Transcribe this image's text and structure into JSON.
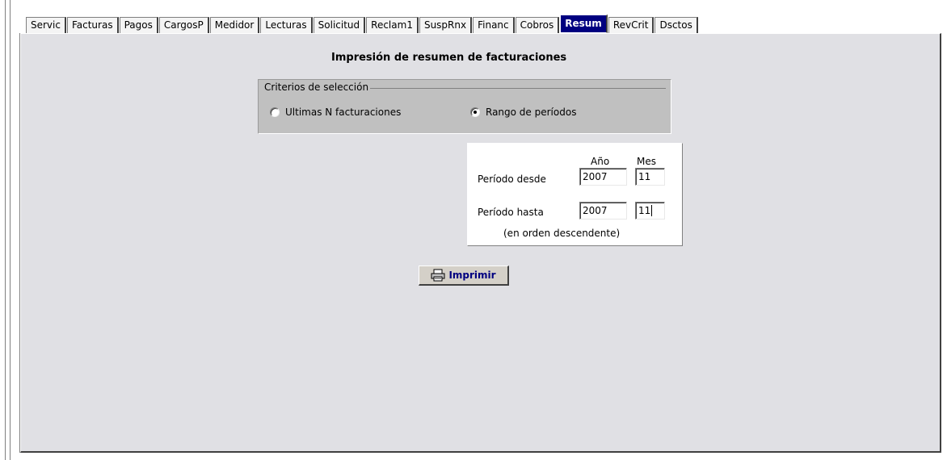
{
  "tabs": [
    {
      "label": "Servic"
    },
    {
      "label": "Facturas"
    },
    {
      "label": "Pagos"
    },
    {
      "label": "CargosP"
    },
    {
      "label": "Medidor"
    },
    {
      "label": "Lecturas"
    },
    {
      "label": "Solicitud"
    },
    {
      "label": "Reclam1"
    },
    {
      "label": "SuspRnx"
    },
    {
      "label": "Financ"
    },
    {
      "label": "Cobros"
    },
    {
      "label": "Resum",
      "active": true
    },
    {
      "label": "RevCrit"
    },
    {
      "label": "Dsctos"
    }
  ],
  "title": "Impresión de resumen de facturaciones",
  "criteria": {
    "legend": "Criterios de selección",
    "option_last_n": "Ultimas N facturaciones",
    "option_range": "Rango de períodos",
    "selected": "range"
  },
  "range": {
    "col_year": "Año",
    "col_month": "Mes",
    "from_label": "Período desde",
    "to_label": "Período hasta",
    "from_year": "2007",
    "from_month": "11",
    "to_year": "2007",
    "to_month": "11",
    "note": "(en orden descendente)"
  },
  "print_button": {
    "label": "Imprimir",
    "icon": "printer-icon"
  },
  "colors": {
    "active_tab": "#000080",
    "panel": "#e0e0e4",
    "group": "#c0c0c0"
  }
}
